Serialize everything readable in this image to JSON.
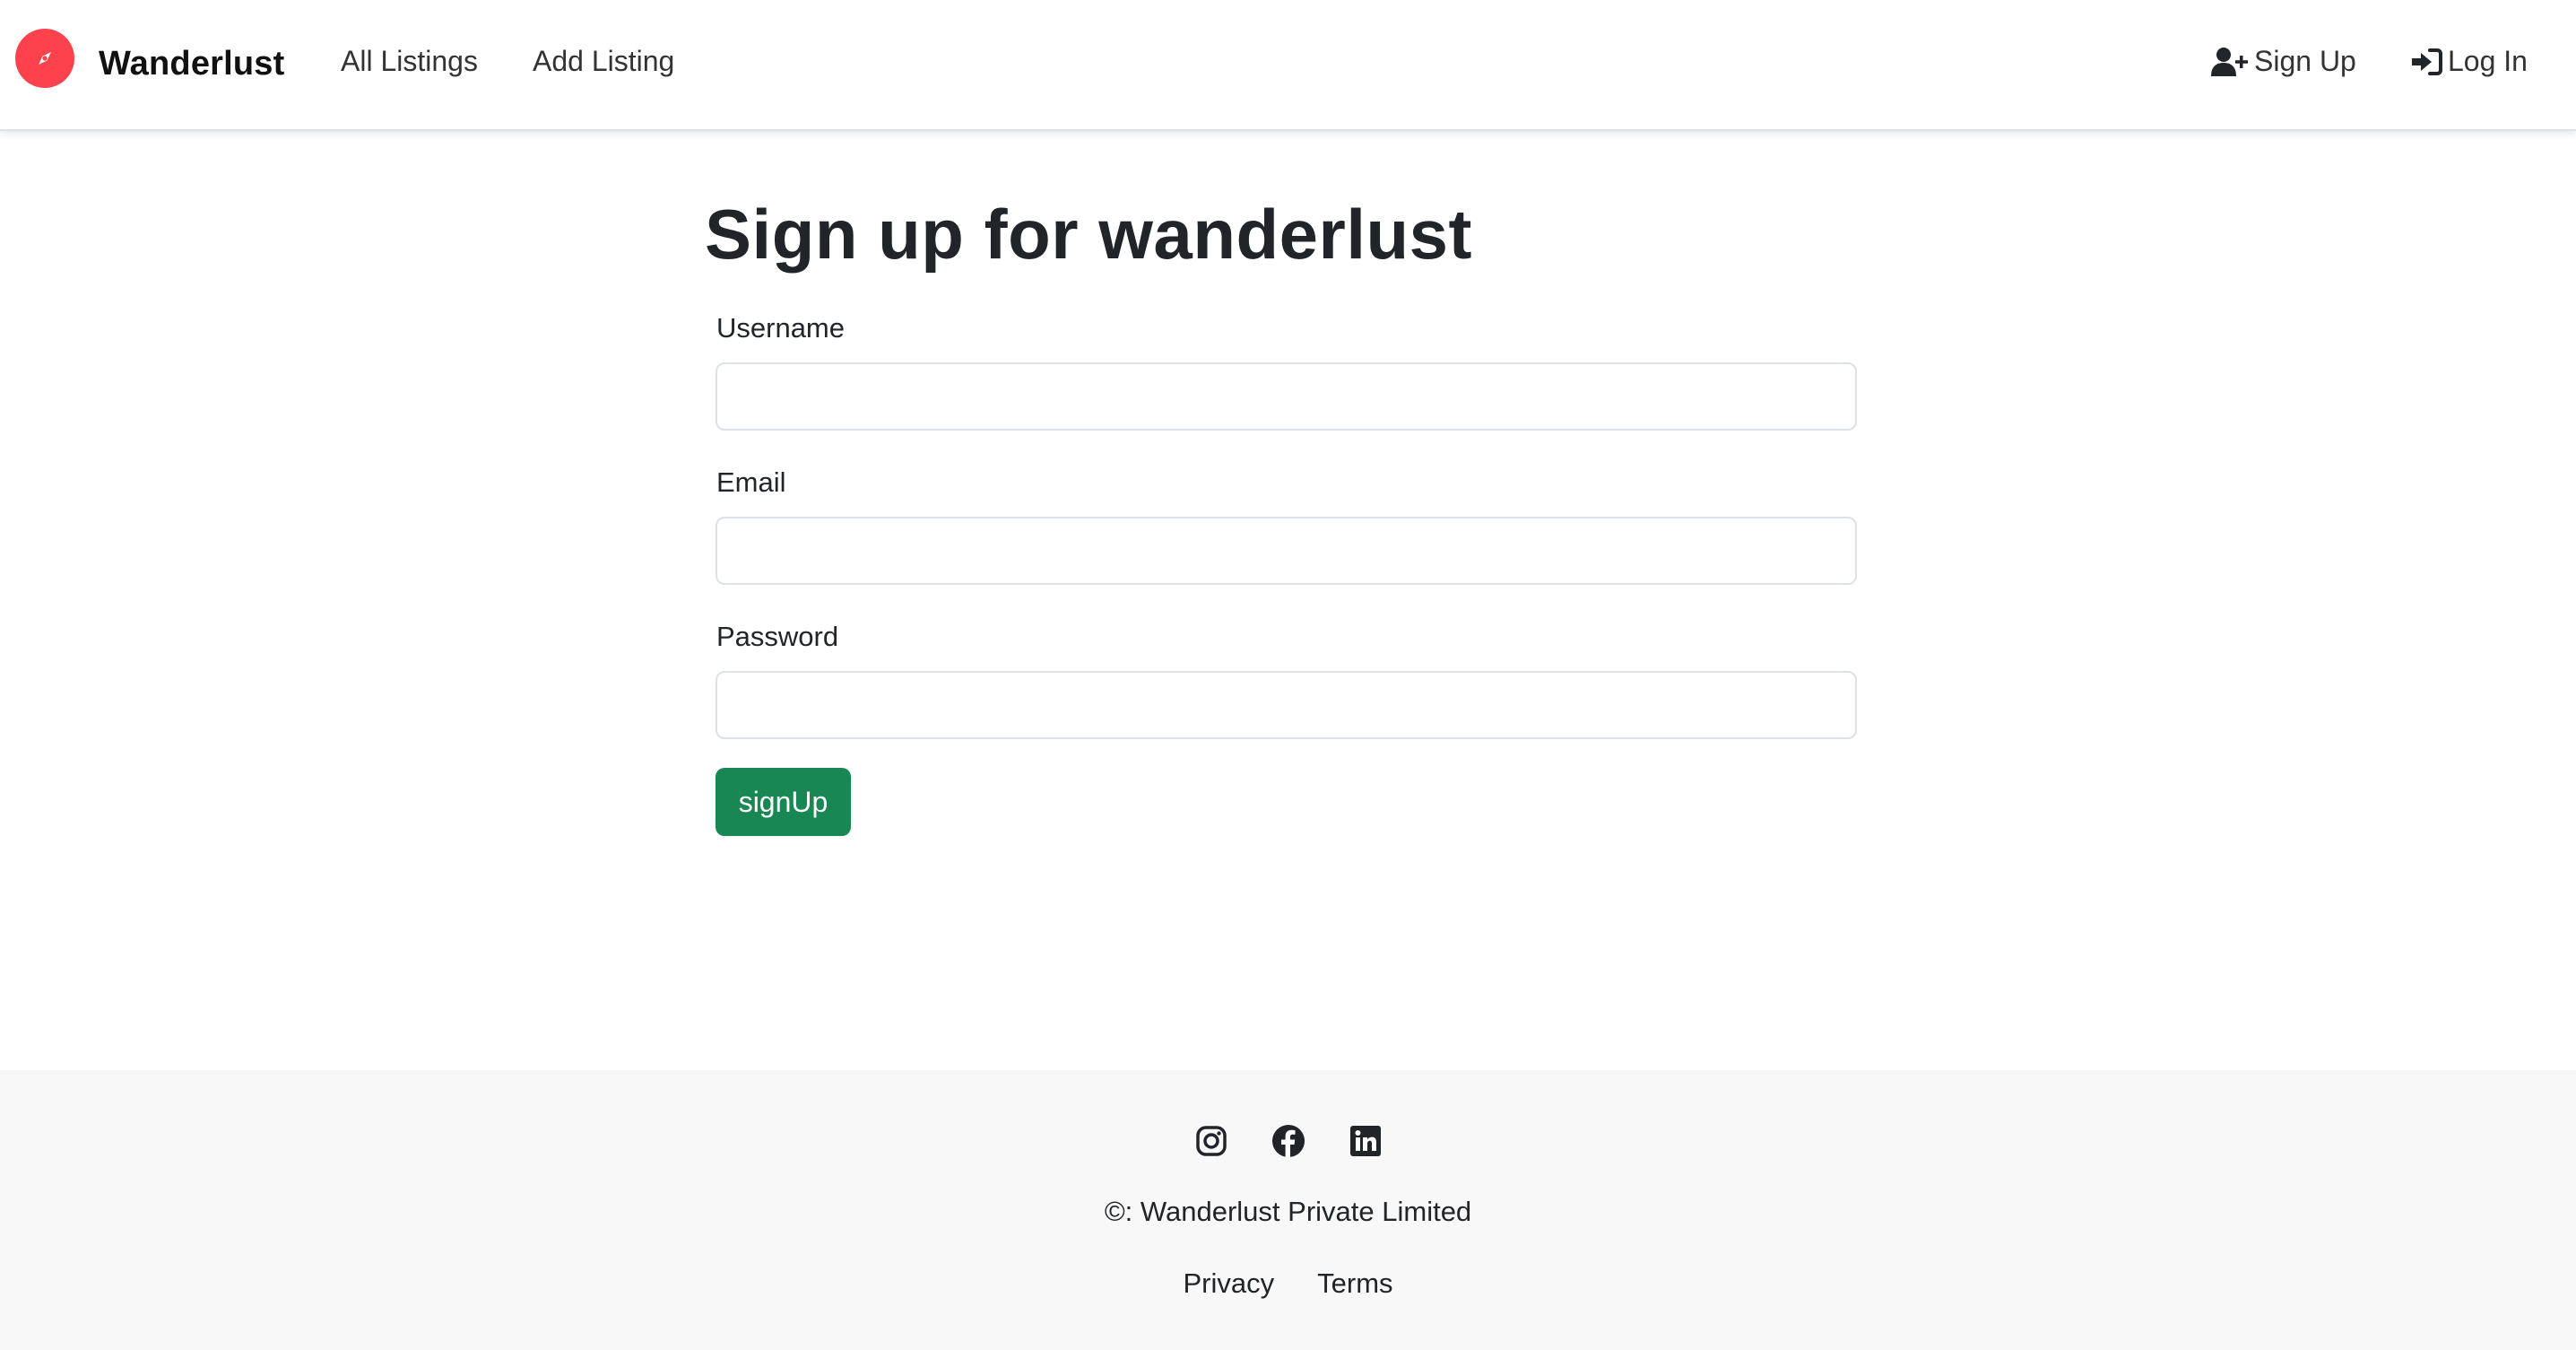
{
  "navbar": {
    "brand": "Wanderlust",
    "logo_icon": "compass-icon",
    "links": [
      "All Listings",
      "Add Listing"
    ],
    "signup": {
      "label": "Sign Up",
      "icon": "user-plus-icon"
    },
    "login": {
      "label": "Log In",
      "icon": "sign-in-icon"
    }
  },
  "form": {
    "title": "Sign up for wanderlust",
    "fields": [
      {
        "label": "Username",
        "value": "",
        "placeholder": ""
      },
      {
        "label": "Email",
        "value": "",
        "placeholder": ""
      },
      {
        "label": "Password",
        "value": "",
        "placeholder": ""
      }
    ],
    "submit_label": "signUp"
  },
  "footer": {
    "socials": [
      "instagram-icon",
      "facebook-icon",
      "linkedin-icon"
    ],
    "copyright": "©: Wanderlust Private Limited",
    "links": [
      "Privacy",
      "Terms"
    ]
  },
  "colors": {
    "brand": "#fe424d",
    "submit": "#198754",
    "footer_bg": "#f8f8f8"
  }
}
